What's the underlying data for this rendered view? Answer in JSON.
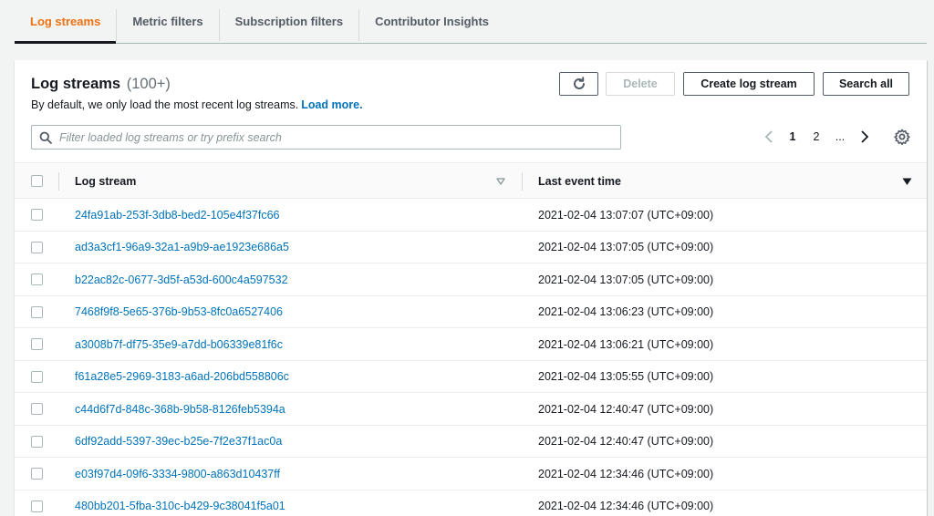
{
  "tabs": [
    {
      "label": "Log streams",
      "active": true
    },
    {
      "label": "Metric filters",
      "active": false
    },
    {
      "label": "Subscription filters",
      "active": false
    },
    {
      "label": "Contributor Insights",
      "active": false
    }
  ],
  "panel": {
    "title": "Log streams",
    "count": "(100+)",
    "description": "By default, we only load the most recent log streams.",
    "load_more": "Load more.",
    "buttons": {
      "refresh_icon": "refresh-icon",
      "delete": "Delete",
      "create": "Create log stream",
      "search_all": "Search all"
    },
    "filter_placeholder": "Filter loaded log streams or try prefix search",
    "pagination": {
      "prev": "‹",
      "page1": "1",
      "page2": "2",
      "ellipsis": "...",
      "next": "›",
      "current_page": 1
    }
  },
  "table": {
    "columns": {
      "stream": "Log stream",
      "time": "Last event time"
    },
    "rows": [
      {
        "stream": "24fa91ab-253f-3db8-bed2-105e4f37fc66",
        "time": "2021-02-04 13:07:07 (UTC+09:00)"
      },
      {
        "stream": "ad3a3cf1-96a9-32a1-a9b9-ae1923e686a5",
        "time": "2021-02-04 13:07:05 (UTC+09:00)"
      },
      {
        "stream": "b22ac82c-0677-3d5f-a53d-600c4a597532",
        "time": "2021-02-04 13:07:05 (UTC+09:00)"
      },
      {
        "stream": "7468f9f8-5e65-376b-9b53-8fc0a6527406",
        "time": "2021-02-04 13:06:23 (UTC+09:00)"
      },
      {
        "stream": "a3008b7f-df75-35e9-a7dd-b06339e81f6c",
        "time": "2021-02-04 13:06:21 (UTC+09:00)"
      },
      {
        "stream": "f61a28e5-2969-3183-a6ad-206bd558806c",
        "time": "2021-02-04 13:05:55 (UTC+09:00)"
      },
      {
        "stream": "c44d6f7d-848c-368b-9b58-8126feb5394a",
        "time": "2021-02-04 12:40:47 (UTC+09:00)"
      },
      {
        "stream": "6df92add-5397-39ec-b25e-7f2e37f1ac0a",
        "time": "2021-02-04 12:40:47 (UTC+09:00)"
      },
      {
        "stream": "e03f97d4-09f6-3334-9800-a863d10437ff",
        "time": "2021-02-04 12:34:46 (UTC+09:00)"
      },
      {
        "stream": "480bb201-5fba-310c-b429-9c38041f5a01",
        "time": "2021-02-04 12:34:46 (UTC+09:00)"
      }
    ]
  },
  "colors": {
    "accent": "#ec7211",
    "link": "#0073bb",
    "text": "#16191f"
  }
}
